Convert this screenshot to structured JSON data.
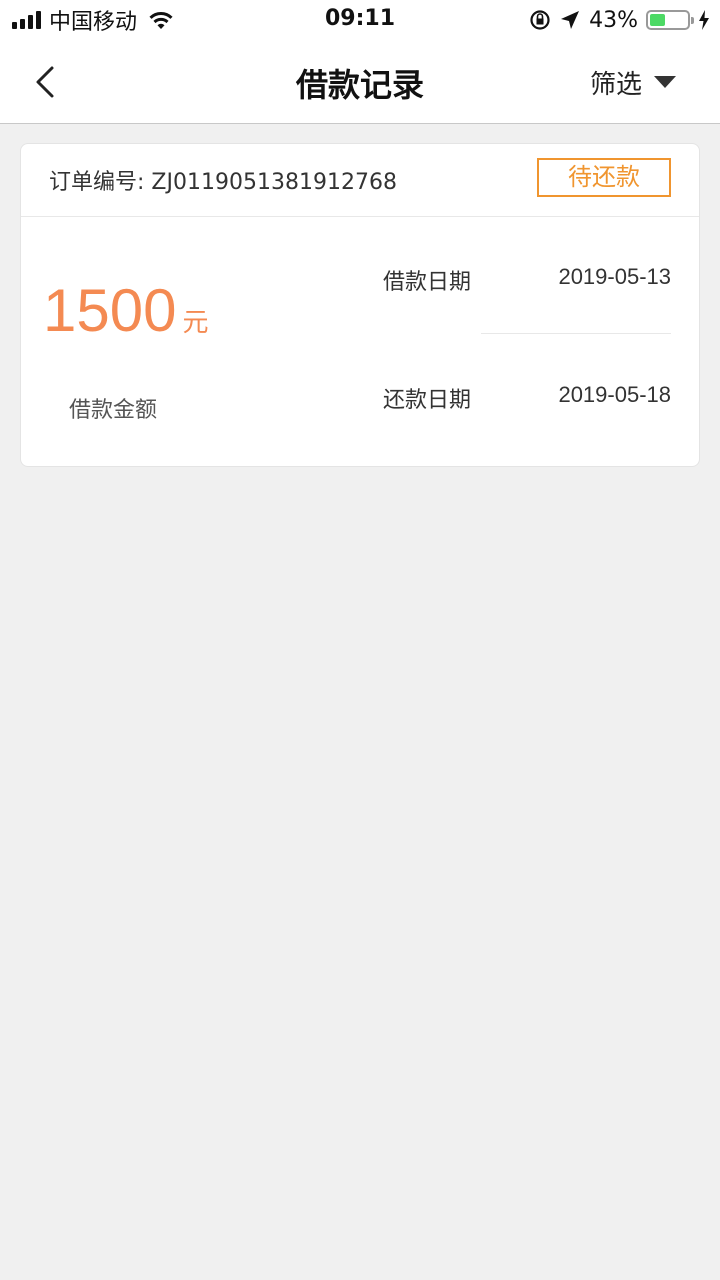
{
  "status_bar": {
    "carrier": "中国移动",
    "time": "09:11",
    "battery_percent": "43%",
    "battery_level": 0.43
  },
  "nav": {
    "title": "借款记录",
    "filter_label": "筛选"
  },
  "record": {
    "order_label": "订单编号:",
    "order_number": "ZJ0119051381912768",
    "status": "待还款",
    "amount": "1500",
    "amount_unit": "元",
    "amount_label": "借款金额",
    "loan_date_label": "借款日期",
    "loan_date": "2019-05-13",
    "repay_date_label": "还款日期",
    "repay_date": "2019-05-18"
  },
  "colors": {
    "accent": "#f48a52",
    "status_border": "#f0952f",
    "battery": "#4cd964",
    "background": "#f0f0f0"
  }
}
